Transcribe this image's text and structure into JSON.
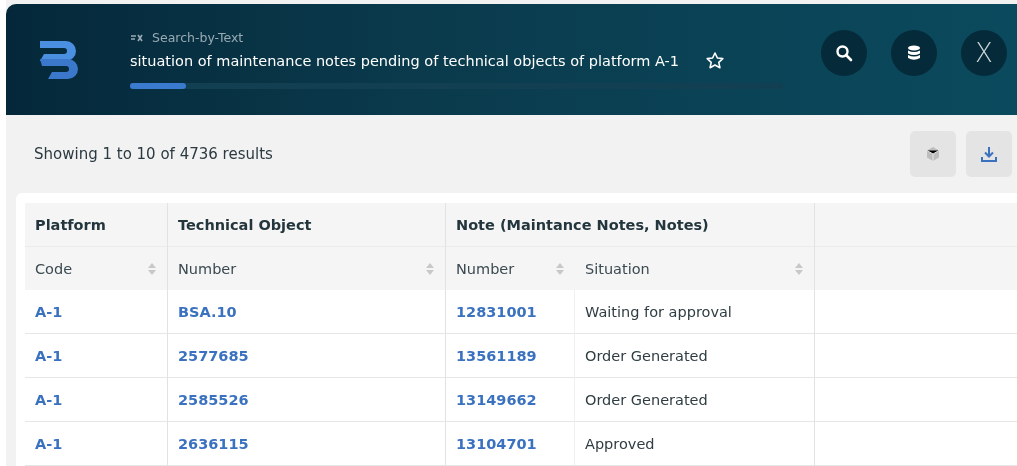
{
  "header": {
    "breadcrumb": "Search-by-Text",
    "query": "situation of maintenance notes pending of technical objects of platform A-1",
    "favorite": false,
    "progress": {
      "level": 0.085
    },
    "close_label": "X"
  },
  "results": {
    "summary": "Showing 1 to 10 of 4736 results",
    "toolbar": [
      {
        "kind": "cube",
        "disabled": true
      },
      {
        "kind": "download",
        "disabled": false
      }
    ]
  },
  "table": {
    "groups": [
      {
        "label": "Platform",
        "columns": [
          {
            "label": "Code",
            "kind": "link"
          }
        ]
      },
      {
        "label": "Technical Object",
        "columns": [
          {
            "label": "Number",
            "kind": "link"
          }
        ]
      },
      {
        "label": "Note (Maintance Notes, Notes)",
        "columns": [
          {
            "label": "Number",
            "kind": "link"
          },
          {
            "label": "Situation",
            "kind": "text"
          }
        ]
      }
    ],
    "rows": [
      [
        "A-1",
        "BSA.10",
        "12831001",
        "Waiting for approval"
      ],
      [
        "A-1",
        "2577685",
        "13561189",
        "Order Generated"
      ],
      [
        "A-1",
        "2585526",
        "13149662",
        "Order Generated"
      ],
      [
        "A-1",
        "2636115",
        "13104701",
        "Approved"
      ]
    ]
  }
}
